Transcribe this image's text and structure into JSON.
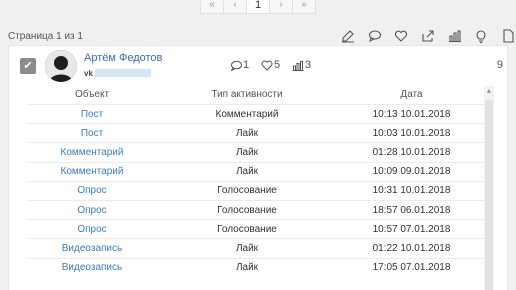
{
  "pagination": {
    "first": "«",
    "prev": "‹",
    "current": "1",
    "next": "›",
    "last": "»"
  },
  "page_info": "Страница 1 из 1",
  "toolbar": [
    "edit-icon",
    "comment-icon",
    "heart-icon",
    "share-icon",
    "chart-icon",
    "lightbulb-icon",
    "file-icon"
  ],
  "user": {
    "name": "Артём Федотов",
    "network": "vk",
    "comments": "1",
    "likes": "5",
    "stats": "3",
    "total": "9"
  },
  "table": {
    "headers": [
      "Объект",
      "Тип активности",
      "Дата"
    ],
    "rows": [
      [
        "Пост",
        "Комментарий",
        "10:13 10.01.2018"
      ],
      [
        "Пост",
        "Лайк",
        "10:03 10.01.2018"
      ],
      [
        "Комментарий",
        "Лайк",
        "01:28 10.01.2018"
      ],
      [
        "Комментарий",
        "Лайк",
        "10:09 09.01.2018"
      ],
      [
        "Опрос",
        "Голосование",
        "10:31 10.01.2018"
      ],
      [
        "Опрос",
        "Голосование",
        "18:57 06.01.2018"
      ],
      [
        "Опрос",
        "Голосование",
        "10:57 07.01.2018"
      ],
      [
        "Видеозапись",
        "Лайк",
        "01:22 10.01.2018"
      ],
      [
        "Видеозапись",
        "Лайк",
        "17:05 07.01.2018"
      ]
    ]
  },
  "colors": {
    "link": "#3b7dc4",
    "name": "#3b6fb5",
    "checkbox": "#8c8c8c"
  }
}
